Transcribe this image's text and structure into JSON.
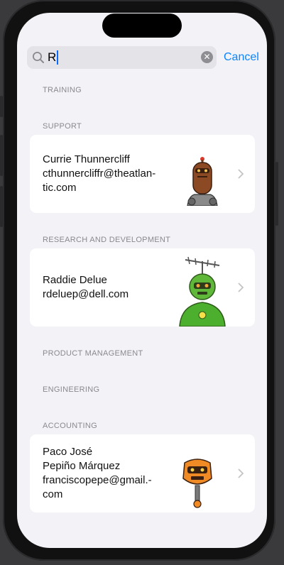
{
  "search": {
    "query": "R",
    "cancel_label": "Cancel",
    "icon": "magnifying-glass",
    "clear_icon": "x-circle"
  },
  "sections": [
    {
      "header": "TRAINING"
    },
    {
      "header": "SUPPORT",
      "contact": {
        "name": "Currie Thunnercliff",
        "email_line1": "cthunnercliffr@theatlan-",
        "email_line2": "tic.com",
        "avatar": "brown-robot"
      }
    },
    {
      "header": "RESEARCH AND DEVELOPMENT",
      "contact": {
        "name": "Raddie Delue",
        "email_line1": "rdeluep@dell.com",
        "avatar": "green-antenna-robot"
      }
    },
    {
      "header": "PRODUCT MANAGEMENT"
    },
    {
      "header": "ENGINEERING"
    },
    {
      "header": "ACCOUNTING",
      "contact": {
        "name_line1": "Paco José",
        "name_line2": "Pepiño Márquez",
        "email_line1": "franciscopepe@gmail.-",
        "email_line2": "com",
        "avatar": "orange-robot"
      }
    }
  ],
  "colors": {
    "accent": "#0a84ff",
    "background": "#f2f2f7",
    "card": "#ffffff"
  }
}
